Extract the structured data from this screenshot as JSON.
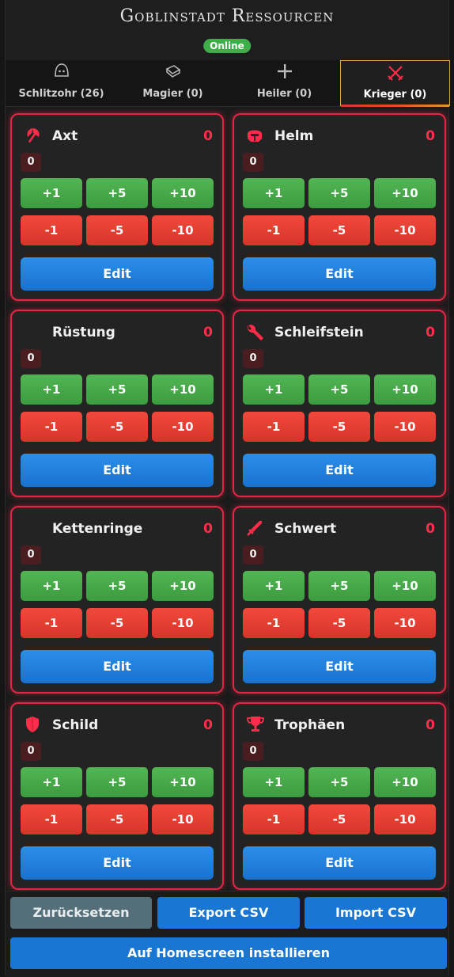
{
  "header": {
    "title": "Goblinstadt Ressourcen",
    "status": "Online"
  },
  "tabs": [
    {
      "label": "Schlitzohr (26)",
      "icon": "hood-icon"
    },
    {
      "label": "Magier (0)",
      "icon": "spellbook-icon"
    },
    {
      "label": "Heiler (0)",
      "icon": "plus-icon"
    },
    {
      "label": "Krieger (0)",
      "icon": "crossed-swords-icon",
      "active": true
    }
  ],
  "buttons": {
    "plus1": "+1",
    "plus5": "+5",
    "plus10": "+10",
    "minus1": "-1",
    "minus5": "-5",
    "minus10": "-10",
    "edit": "Edit"
  },
  "cards": [
    {
      "name": "Axt",
      "total": "0",
      "count": "0",
      "icon": "axe-icon"
    },
    {
      "name": "Helm",
      "total": "0",
      "count": "0",
      "icon": "helmet-icon"
    },
    {
      "name": "Rüstung",
      "total": "0",
      "count": "0",
      "icon": ""
    },
    {
      "name": "Schleifstein",
      "total": "0",
      "count": "0",
      "icon": "wrench-icon"
    },
    {
      "name": "Kettenringe",
      "total": "0",
      "count": "0",
      "icon": ""
    },
    {
      "name": "Schwert",
      "total": "0",
      "count": "0",
      "icon": "sword-icon"
    },
    {
      "name": "Schild",
      "total": "0",
      "count": "0",
      "icon": "shield-icon"
    },
    {
      "name": "Trophäen",
      "total": "0",
      "count": "0",
      "icon": "trophy-icon"
    }
  ],
  "footer": {
    "reset": "Zurücksetzen",
    "export": "Export CSV",
    "import": "Import CSV",
    "install": "Auf Homescreen installieren"
  },
  "colors": {
    "accent_red": "#e02846",
    "plus_green": "#4caf50",
    "minus_red": "#f44336",
    "edit_blue": "#1e88e5",
    "reset_gray": "#546e7a"
  }
}
